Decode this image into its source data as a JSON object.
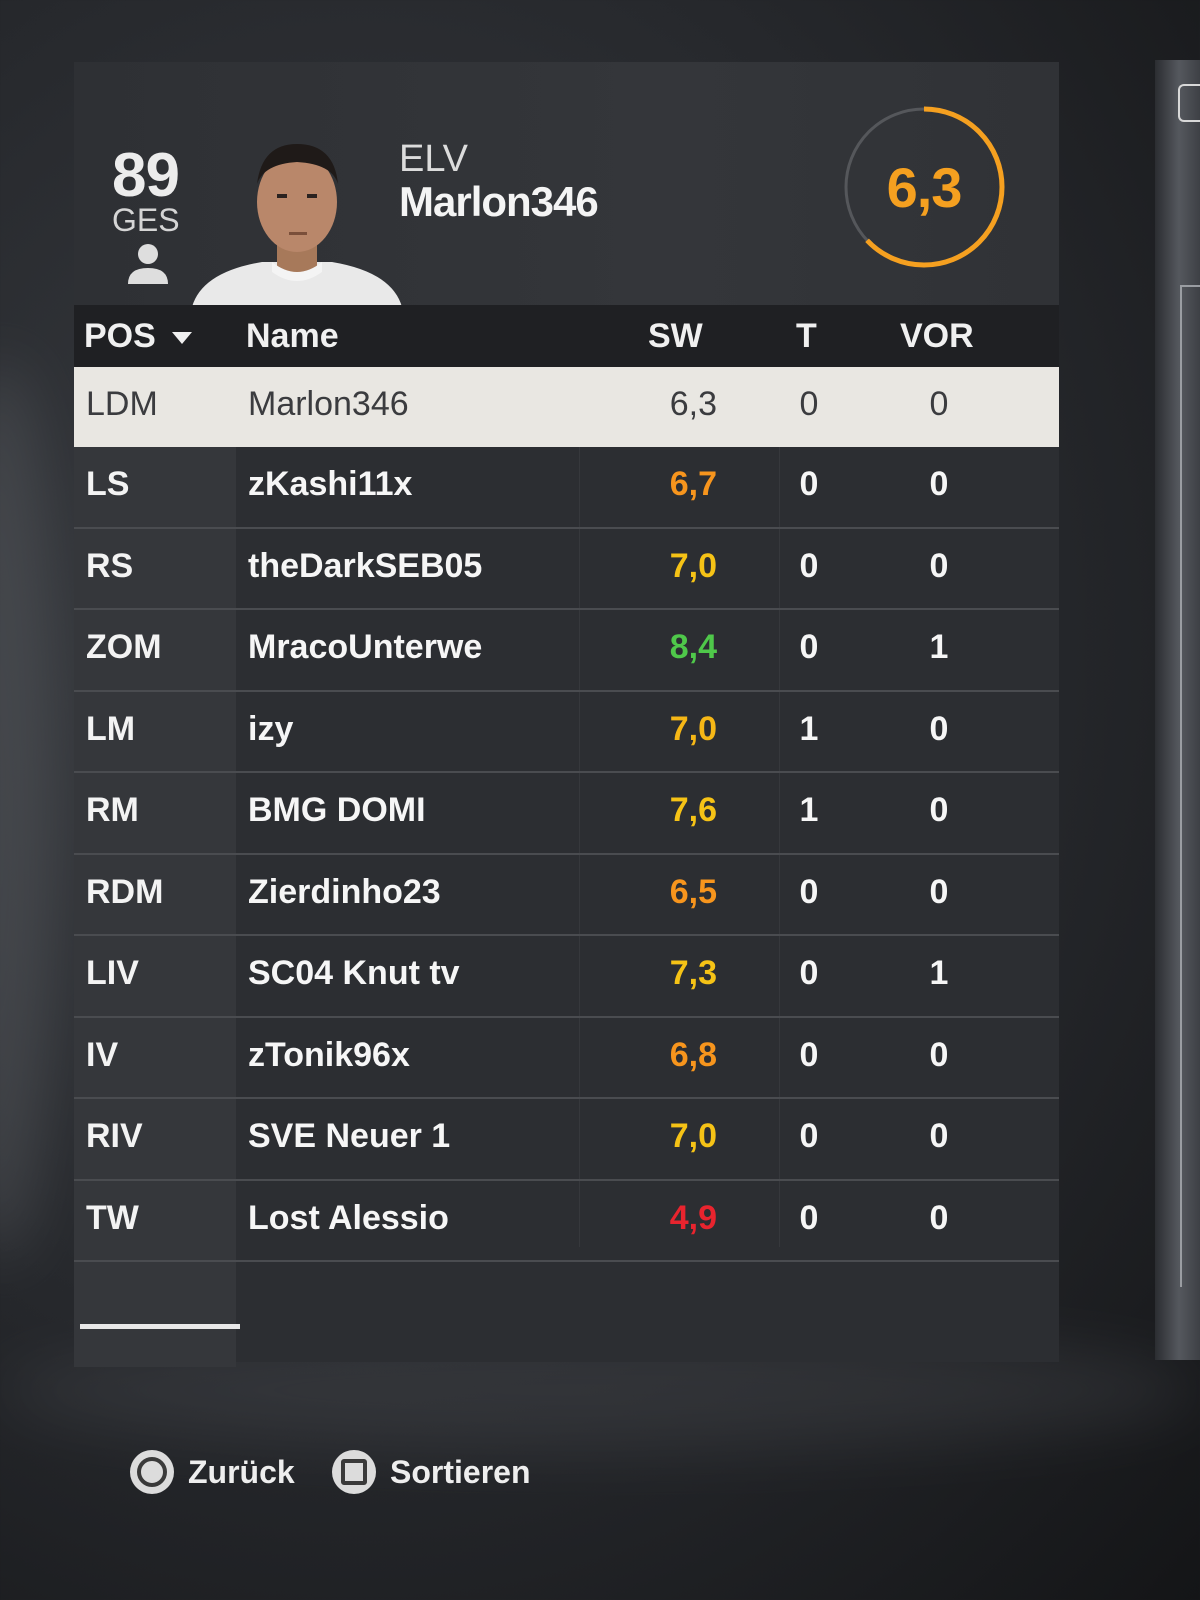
{
  "header": {
    "overall_value": "89",
    "overall_label": "GES",
    "club_code": "ELV",
    "player_name": "Marlon346",
    "match_rating": "6,3",
    "match_rating_fraction": 0.63,
    "rating_color": "#f5a020"
  },
  "table": {
    "columns": {
      "pos": "POS",
      "name": "Name",
      "sw": "SW",
      "t": "T",
      "vor": "VOR"
    },
    "rows": [
      {
        "pos": "LDM",
        "name": "Marlon346",
        "sw": "6,3",
        "t": "0",
        "vor": "0",
        "sw_color": "#3b3c3f"
      },
      {
        "pos": "LS",
        "name": "zKashi11x",
        "sw": "6,7",
        "t": "0",
        "vor": "0",
        "sw_color": "#f7951d"
      },
      {
        "pos": "RS",
        "name": "theDarkSEB05",
        "sw": "7,0",
        "t": "0",
        "vor": "0",
        "sw_color": "#f6c316"
      },
      {
        "pos": "ZOM",
        "name": "MracoUnterwe",
        "sw": "8,4",
        "t": "0",
        "vor": "1",
        "sw_color": "#4fc84a"
      },
      {
        "pos": "LM",
        "name": "izy",
        "sw": "7,0",
        "t": "1",
        "vor": "0",
        "sw_color": "#f6b716"
      },
      {
        "pos": "RM",
        "name": "BMG DOMI",
        "sw": "7,6",
        "t": "1",
        "vor": "0",
        "sw_color": "#f6c316"
      },
      {
        "pos": "RDM",
        "name": "Zierdinho23",
        "sw": "6,5",
        "t": "0",
        "vor": "0",
        "sw_color": "#f7951d"
      },
      {
        "pos": "LIV",
        "name": "SC04 Knut tv",
        "sw": "7,3",
        "t": "0",
        "vor": "1",
        "sw_color": "#f6c316"
      },
      {
        "pos": "IV",
        "name": "zTonik96x",
        "sw": "6,8",
        "t": "0",
        "vor": "0",
        "sw_color": "#f7951d"
      },
      {
        "pos": "RIV",
        "name": "SVE Neuer 1",
        "sw": "7,0",
        "t": "0",
        "vor": "0",
        "sw_color": "#f6c316"
      },
      {
        "pos": "TW",
        "name": "Lost Alessio",
        "sw": "4,9",
        "t": "0",
        "vor": "0",
        "sw_color": "#e8242e"
      }
    ]
  },
  "footer": {
    "back_label": "Zurück",
    "sort_label": "Sortieren",
    "back_icon": "circle-button-icon",
    "sort_icon": "square-button-icon"
  }
}
